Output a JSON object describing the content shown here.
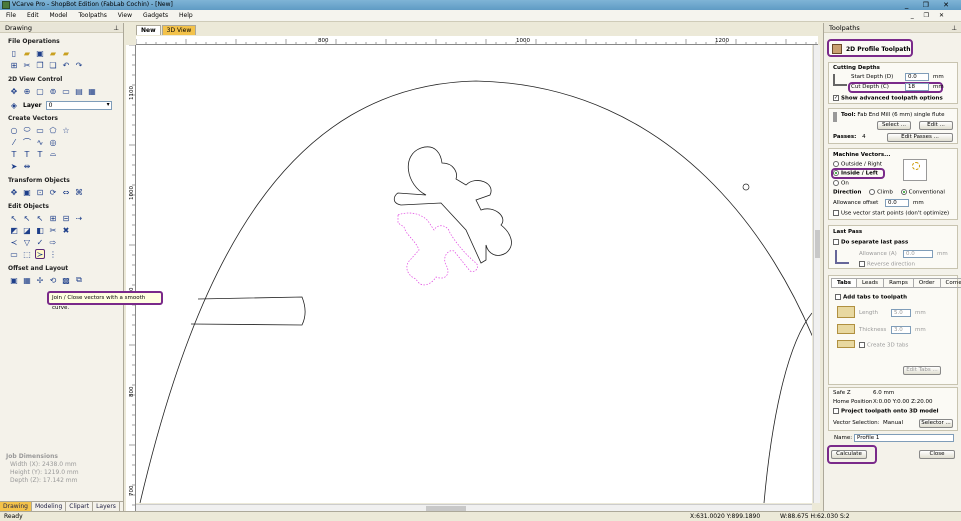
{
  "window": {
    "title": "VCarve Pro - ShopBot Edition (FabLab Cochin) - [New]",
    "controls": "_ ❐ ✕"
  },
  "menu": [
    "File",
    "Edit",
    "Model",
    "Toolpaths",
    "View",
    "Gadgets",
    "Help"
  ],
  "menu_right_controls": "_ ❐ ✕",
  "left_panel": {
    "title": "Drawing",
    "pin": "⊥",
    "sections": {
      "file_ops": "File Operations",
      "view_control": "2D View Control",
      "create_vectors": "Create Vectors",
      "transform": "Transform Objects",
      "edit_objects": "Edit Objects",
      "offset": "Offset and Layout"
    },
    "layer_label": "Layer",
    "layer_value": "0",
    "job": {
      "title": "Job Dimensions",
      "width": "Width  (X): 2438.0 mm",
      "height": "Height (Y): 1219.0 mm",
      "depth": "Depth  (Z): 17.142 mm"
    },
    "tabs": [
      "Drawing",
      "Modeling",
      "Clipart",
      "Layers"
    ]
  },
  "tooltip": "Join / Close vectors with a smooth curve.",
  "document_tabs": [
    "New",
    "3D View"
  ],
  "ruler": {
    "h_labels": [
      "800",
      "1000",
      "1200"
    ],
    "v_labels": [
      "1100",
      "1000",
      "900",
      "800",
      "700"
    ]
  },
  "right_panel": {
    "title": "Toolpaths",
    "pin": "⊥",
    "heading": "2D Profile Toolpath",
    "cutting_depths": "Cutting Depths",
    "start_depth_label": "Start Depth (D)",
    "start_depth": "0.0",
    "cut_depth_label": "Cut Depth (C)",
    "cut_depth": "18",
    "unit": "mm",
    "show_advanced": "Show advanced toolpath options",
    "tool_label": "Tool:",
    "tool_name": "Fab End Mill (6 mm) single flute",
    "select_btn": "Select ...",
    "edit_btn": "Edit ...",
    "passes_label": "Passes:",
    "passes_value": "4",
    "edit_passes_btn": "Edit Passes ...",
    "machine_vectors": "Machine Vectors...",
    "outside": "Outside / Right",
    "inside": "Inside / Left",
    "on": "On",
    "direction_label": "Direction",
    "climb": "Climb",
    "conventional": "Conventional",
    "allowance_label": "Allowance offset",
    "allowance_value": "0.0",
    "vector_start": "Use vector start points (don't optimize)",
    "last_pass": "Last Pass",
    "do_separate": "Do separate last pass",
    "lp_allowance_label": "Allowance (A)",
    "lp_allowance": "0.0",
    "reverse_dir": "Reverse direction",
    "subtabs": [
      "Tabs",
      "Leads",
      "Ramps",
      "Order",
      "Corners"
    ],
    "add_tabs": "Add tabs to toolpath",
    "length_label": "Length",
    "length_value": "5.0",
    "thickness_label": "Thickness",
    "thickness_value": "3.0",
    "create_3d_tabs": "Create 3D tabs",
    "edit_tabs_btn": "Edit Tabs ...",
    "safe_z_label": "Safe Z",
    "safe_z": "6.0 mm",
    "home_label": "Home Position",
    "home_value": "X:0.00 Y:0.00 Z:20.00",
    "project_3d": "Project toolpath onto 3D model",
    "vector_sel_label": "Vector Selection:",
    "vector_sel_value": "Manual",
    "selector_btn": "Selector ...",
    "name_label": "Name:",
    "name_value": "Profile 1",
    "calculate_btn": "Calculate",
    "close_btn": "Close"
  },
  "status": {
    "ready": "Ready",
    "coords": "X:631.0020 Y:899.1890",
    "size": "W:88.675   H:62.030  S:2"
  },
  "colors": {
    "highlight": "#7a2a8a",
    "selected_vector": "#e040e0",
    "tab_active": "#f3c24a"
  }
}
